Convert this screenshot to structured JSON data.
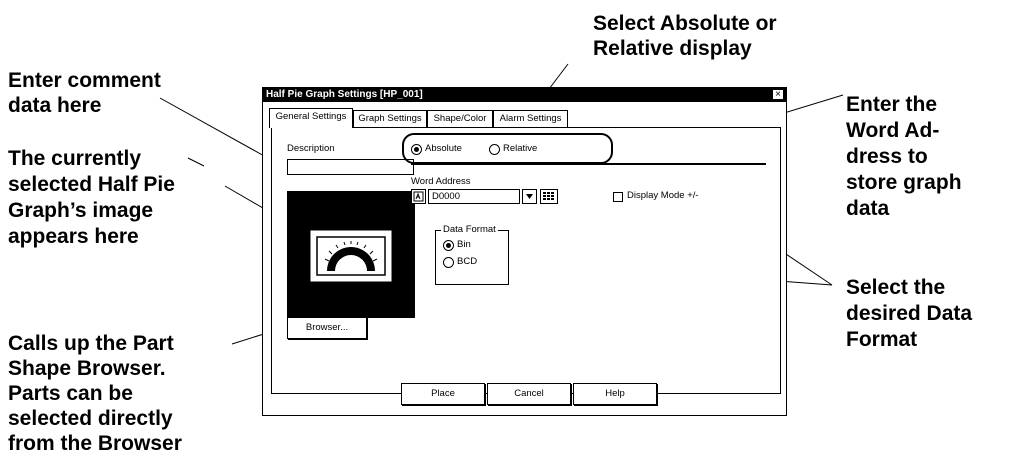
{
  "callouts": {
    "select_display_l1": "Select Absolute or",
    "select_display_l2": "Relative display",
    "comment_l1": "Enter comment",
    "comment_l2": "data here",
    "image_l1": "The currently",
    "image_l2": "selected Half Pie",
    "image_l3": "Graph’s image",
    "image_l4": "appears here",
    "browser_l1": "Calls up the Part",
    "browser_l2": "Shape Browser.",
    "browser_l3": "Parts can be",
    "browser_l4": "selected directly",
    "browser_l5": "from the Browser",
    "word_l1": "Enter the",
    "word_l2": "Word Ad-",
    "word_l3": "dress to",
    "word_l4": "store graph",
    "word_l5": "data",
    "format_l1": "Select the",
    "format_l2": "desired Data",
    "format_l3": "Format"
  },
  "dialog": {
    "title": "Half Pie Graph Settings [HP_001]",
    "close_glyph": "×",
    "tabs": [
      {
        "label": "General Settings",
        "active": true
      },
      {
        "label": "Graph Settings",
        "active": false
      },
      {
        "label": "Shape/Color",
        "active": false
      },
      {
        "label": "Alarm Settings",
        "active": false
      }
    ],
    "description_label": "Description",
    "description_value": "",
    "display_options": {
      "absolute": "Absolute",
      "relative": "Relative",
      "selected": "absolute"
    },
    "word_address_label": "Word Address",
    "word_address_value": "D0000",
    "display_mode_label": "Display Mode +/-",
    "display_mode_checked": false,
    "data_format_title": "Data Format",
    "data_format_options": {
      "bin": "Bin",
      "bcd": "BCD",
      "selected": "bin"
    },
    "browser_button": "Browser...",
    "buttons": {
      "place": "Place",
      "cancel": "Cancel",
      "help": "Help"
    }
  },
  "colors": {
    "background": "#ffffff",
    "titlebar": "#000000",
    "preview_bg": "#000000",
    "text": "#000000"
  }
}
